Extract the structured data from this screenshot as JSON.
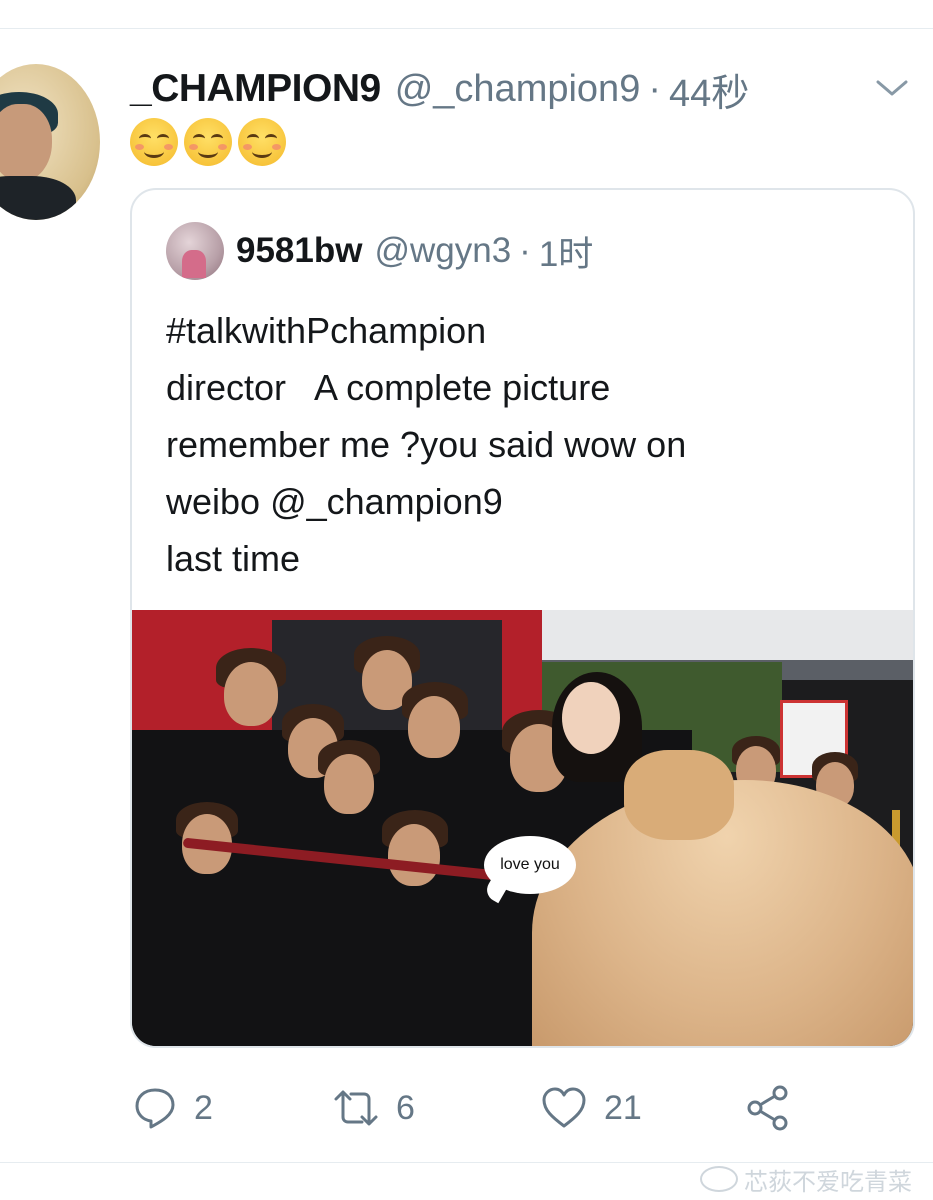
{
  "tweet": {
    "display_name": "_CHAMPION9",
    "handle": "@_champion9",
    "separator": "·",
    "time": "44秒",
    "emojis": [
      "smiling-face-emoji",
      "smiling-face-emoji",
      "smiling-face-emoji"
    ]
  },
  "quoted_tweet": {
    "display_name": "9581bw",
    "handle": "@wgyn3",
    "separator": "·",
    "time": "1时",
    "text_lines": [
      "#talkwithPchampion",
      "director   A complete picture",
      "remember me ?you said wow on",
      "weibo @_champion9",
      "last time"
    ],
    "image": {
      "speech_bubble_text": "love you"
    }
  },
  "actions": {
    "reply_count": "2",
    "retweet_count": "6",
    "like_count": "21"
  },
  "watermark": {
    "text": "芯荻不爱吃青菜"
  },
  "colors": {
    "text_primary": "#14171a",
    "text_secondary": "#657786",
    "border": "#dfe5ea",
    "divider": "#e6ecf0",
    "icon": "#657786"
  }
}
